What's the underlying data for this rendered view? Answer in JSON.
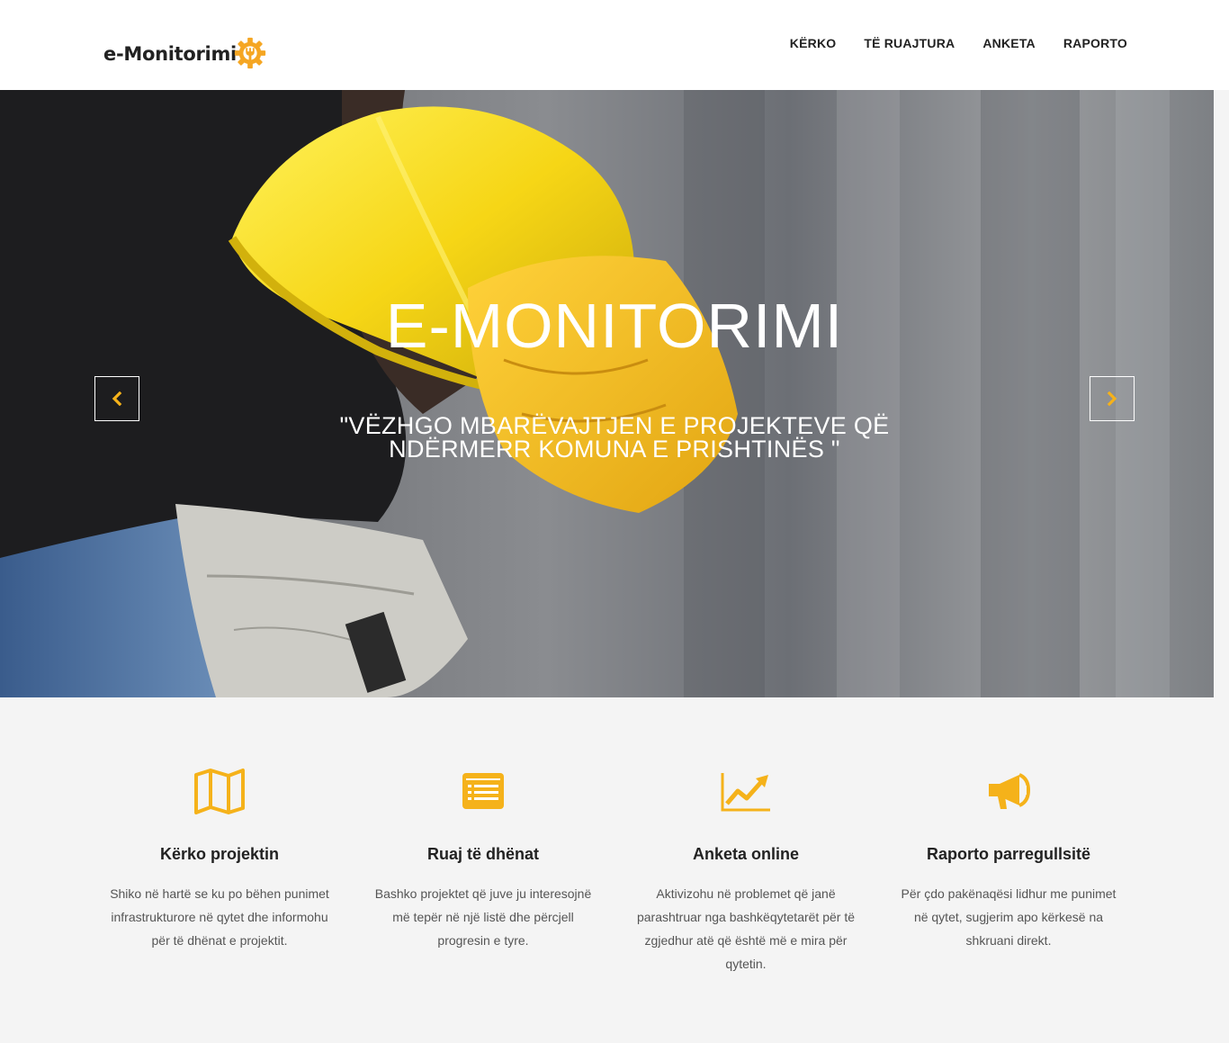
{
  "header": {
    "logo_text": "e-Monitorimi",
    "nav": [
      "KËRKO",
      "TË RUAJTURA",
      "ANKETA",
      "RAPORTO"
    ]
  },
  "hero": {
    "title": "E-MONITORIMI",
    "subtitle": "\"VËZHGO MBARËVAJTJEN E PROJEKTEVE QË NDËRMERR KOMUNA E PRISHTINËS \"",
    "prev_icon": "chevron-left-icon",
    "next_icon": "chevron-right-icon"
  },
  "features": [
    {
      "icon": "map-icon",
      "title": "Kërko projektin",
      "text": "Shiko në hartë se ku po bëhen punimet infrastrukturore në qytet dhe informohu për të dhënat e projektit."
    },
    {
      "icon": "list-icon",
      "title": "Ruaj të dhënat",
      "text": "Bashko projektet që juve ju interesojnë më tepër në një listë dhe përcjell progresin e tyre."
    },
    {
      "icon": "chart-line-icon",
      "title": "Anketa online",
      "text": "Aktivizohu në problemet që janë parashtruar nga bashkëqytetarët për të zgjedhur atë që është më e mira për qytetin."
    },
    {
      "icon": "megaphone-icon",
      "title": "Raporto parregullsitë",
      "text": "Për çdo pakënaqësi lidhur me punimet në qytet, sugjerim apo kërkesë na shkruani direkt."
    }
  ],
  "colors": {
    "accent": "#f5b21a",
    "helmet": "#f6d616",
    "section_bg": "#f4f4f4"
  }
}
